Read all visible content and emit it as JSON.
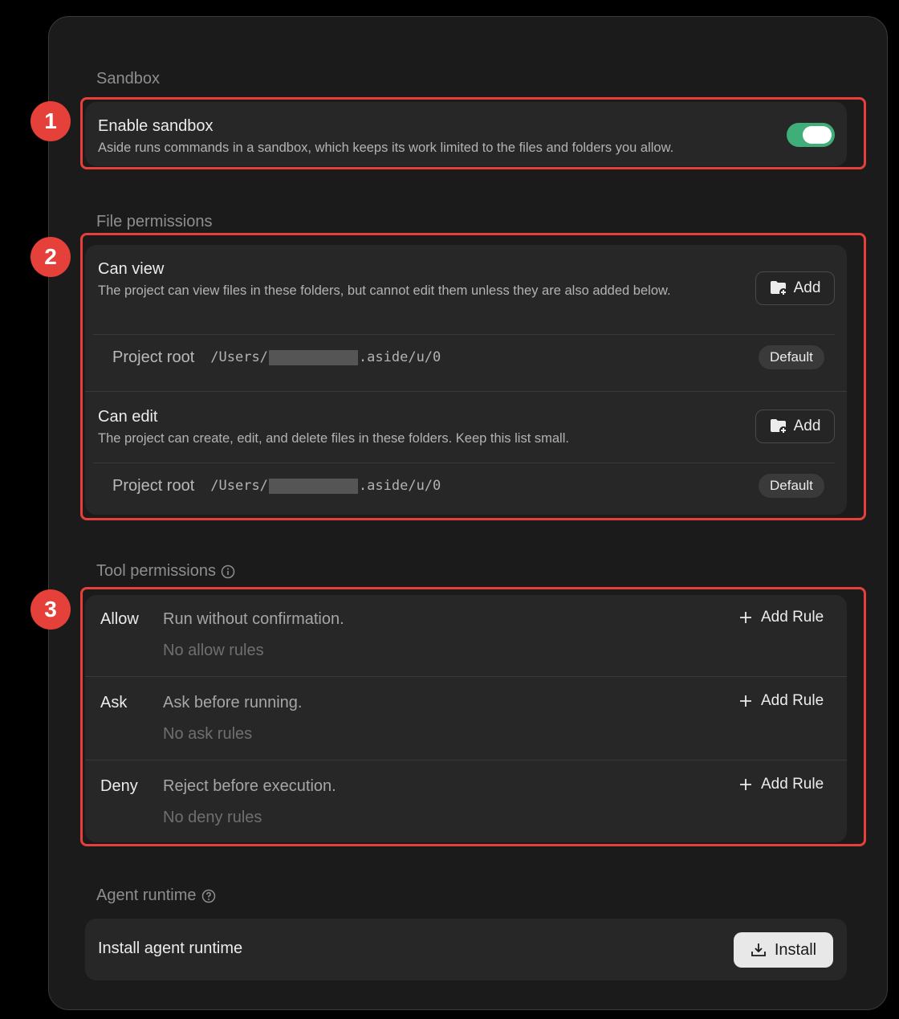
{
  "sandbox": {
    "section_title": "Sandbox",
    "title": "Enable sandbox",
    "description": "Aside runs commands in a sandbox, which keeps its work limited to the files and folders you allow.",
    "enabled": true
  },
  "file_permissions": {
    "section_title": "File permissions",
    "can_view": {
      "title": "Can view",
      "description": "The project can view files in these folders, but cannot edit them unless they are also added below.",
      "add_label": "Add",
      "entry": {
        "label": "Project root",
        "path_prefix": "/Users/",
        "path_suffix": ".aside/u/0",
        "badge": "Default"
      }
    },
    "can_edit": {
      "title": "Can edit",
      "description": "The project can create, edit, and delete files in these folders. Keep this list small.",
      "add_label": "Add",
      "entry": {
        "label": "Project root",
        "path_prefix": "/Users/",
        "path_suffix": ".aside/u/0",
        "badge": "Default"
      }
    }
  },
  "tool_permissions": {
    "section_title": "Tool permissions",
    "rows": [
      {
        "label": "Allow",
        "description": "Run without confirmation.",
        "empty": "No allow rules",
        "button": "Add Rule"
      },
      {
        "label": "Ask",
        "description": "Ask before running.",
        "empty": "No ask rules",
        "button": "Add Rule"
      },
      {
        "label": "Deny",
        "description": "Reject before execution.",
        "empty": "No deny rules",
        "button": "Add Rule"
      }
    ]
  },
  "agent_runtime": {
    "section_title": "Agent runtime",
    "title": "Install agent runtime",
    "button": "Install"
  },
  "annotations": [
    "1",
    "2",
    "3"
  ],
  "colors": {
    "accent_green": "#3fae78",
    "annotation_red": "#e5413a"
  }
}
